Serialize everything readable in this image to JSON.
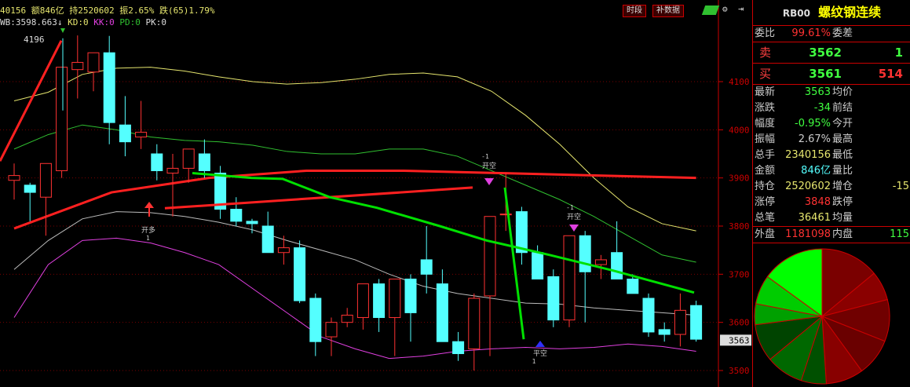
{
  "header": {
    "stats": "40156 额846亿 持2520602 振2.65% 跌(65)1.79%",
    "indicators_wb": "WB:3598.663↓",
    "indicators_kd": "KD:0",
    "indicators_kk": "KK:0",
    "indicators_pd": "PD:0",
    "indicators_pk": "PK:0",
    "high_label": "4196",
    "btn_timeshare": "时段",
    "btn_supplement": "补数据"
  },
  "axis": {
    "labels": [
      "4100",
      "4000",
      "3900",
      "3800",
      "3700",
      "3600",
      "3500"
    ],
    "current_price": "3563"
  },
  "signals": {
    "open_long": "开多",
    "open_long_n": "1",
    "open_short_1": "开空",
    "open_short_1_n": "-1",
    "open_short_2": "开空",
    "open_short_2_n": "-1",
    "close_short": "平空",
    "close_short_n": "1"
  },
  "colors": {
    "up": "#ff3232",
    "down": "#54ffff",
    "ma_fast": "#ff2020",
    "ma_slow": "#00e000",
    "upper_band": "#e6e66e",
    "mid_band": "#30c030",
    "lower_band": "#e040e0",
    "mid_line": "#bbbbbb",
    "accent_red": "#cc0000"
  },
  "chart_data": {
    "type": "candlestick",
    "ylim": [
      3490,
      4200
    ],
    "candles": [
      {
        "o": 3895,
        "h": 3930,
        "l": 3855,
        "c": 3905
      },
      {
        "o": 3885,
        "h": 3890,
        "l": 3810,
        "c": 3870
      },
      {
        "o": 3860,
        "h": 3870,
        "l": 3780,
        "c": 3930
      },
      {
        "o": 3915,
        "h": 4070,
        "l": 3900,
        "c": 4130
      },
      {
        "o": 4125,
        "h": 4196,
        "l": 4065,
        "c": 4140
      },
      {
        "o": 4120,
        "h": 4140,
        "l": 4080,
        "c": 4160
      },
      {
        "o": 4160,
        "h": 4195,
        "l": 3970,
        "c": 4015
      },
      {
        "o": 4010,
        "h": 4070,
        "l": 3945,
        "c": 3975
      },
      {
        "o": 3985,
        "h": 4060,
        "l": 3960,
        "c": 3995
      },
      {
        "o": 3950,
        "h": 3970,
        "l": 3895,
        "c": 3915
      },
      {
        "o": 3910,
        "h": 3950,
        "l": 3820,
        "c": 3920
      },
      {
        "o": 3920,
        "h": 3955,
        "l": 3890,
        "c": 3960
      },
      {
        "o": 3950,
        "h": 3980,
        "l": 3900,
        "c": 3915
      },
      {
        "o": 3910,
        "h": 3925,
        "l": 3815,
        "c": 3835
      },
      {
        "o": 3835,
        "h": 3860,
        "l": 3800,
        "c": 3810
      },
      {
        "o": 3810,
        "h": 3815,
        "l": 3785,
        "c": 3805
      },
      {
        "o": 3800,
        "h": 3830,
        "l": 3750,
        "c": 3745
      },
      {
        "o": 3745,
        "h": 3780,
        "l": 3720,
        "c": 3755
      },
      {
        "o": 3755,
        "h": 3770,
        "l": 3640,
        "c": 3645
      },
      {
        "o": 3650,
        "h": 3660,
        "l": 3530,
        "c": 3560
      },
      {
        "o": 3570,
        "h": 3610,
        "l": 3530,
        "c": 3600
      },
      {
        "o": 3600,
        "h": 3630,
        "l": 3590,
        "c": 3615
      },
      {
        "o": 3610,
        "h": 3640,
        "l": 3585,
        "c": 3680
      },
      {
        "o": 3680,
        "h": 3690,
        "l": 3580,
        "c": 3610
      },
      {
        "o": 3610,
        "h": 3670,
        "l": 3530,
        "c": 3690
      },
      {
        "o": 3690,
        "h": 3700,
        "l": 3560,
        "c": 3620
      },
      {
        "o": 3730,
        "h": 3800,
        "l": 3660,
        "c": 3700
      },
      {
        "o": 3680,
        "h": 3710,
        "l": 3570,
        "c": 3560
      },
      {
        "o": 3560,
        "h": 3580,
        "l": 3520,
        "c": 3535
      },
      {
        "o": 3545,
        "h": 3660,
        "l": 3500,
        "c": 3650
      },
      {
        "o": 3655,
        "h": 3700,
        "l": 3530,
        "c": 3820
      },
      {
        "o": 3825,
        "h": 3910,
        "l": 3790,
        "c": 3825
      },
      {
        "o": 3830,
        "h": 3840,
        "l": 3720,
        "c": 3745
      },
      {
        "o": 3745,
        "h": 3760,
        "l": 3700,
        "c": 3690
      },
      {
        "o": 3695,
        "h": 3710,
        "l": 3590,
        "c": 3605
      },
      {
        "o": 3605,
        "h": 3780,
        "l": 3590,
        "c": 3780
      },
      {
        "o": 3780,
        "h": 3790,
        "l": 3600,
        "c": 3705
      },
      {
        "o": 3720,
        "h": 3740,
        "l": 3690,
        "c": 3730
      },
      {
        "o": 3745,
        "h": 3810,
        "l": 3690,
        "c": 3690
      },
      {
        "o": 3690,
        "h": 3700,
        "l": 3660,
        "c": 3660
      },
      {
        "o": 3650,
        "h": 3660,
        "l": 3570,
        "c": 3580
      },
      {
        "o": 3585,
        "h": 3600,
        "l": 3560,
        "c": 3575
      },
      {
        "o": 3575,
        "h": 3660,
        "l": 3550,
        "c": 3625
      },
      {
        "o": 3635,
        "h": 3645,
        "l": 3560,
        "c": 3565
      }
    ]
  },
  "panel": {
    "code": "RB00",
    "name": "螺纹钢连续",
    "rows_top": [
      {
        "a": "委比",
        "b": "99.61%",
        "bc": "#ff3232",
        "c": "委差",
        "d": "",
        "dc": "#ff3232"
      }
    ],
    "sell": {
      "a": "卖",
      "b": "3562",
      "bc": "#40ff40",
      "d": "1",
      "dc": "#40ff40"
    },
    "buy": {
      "a": "买",
      "b": "3561",
      "bc": "#40ff40",
      "d": "514",
      "dc": "#ff3232"
    },
    "rows": [
      {
        "a": "最新",
        "b": "3563",
        "bc": "#40ff40",
        "c": "均价",
        "d": "",
        "dc": "#ccc"
      },
      {
        "a": "涨跌",
        "b": "-34",
        "bc": "#40ff40",
        "c": "前结",
        "d": "",
        "dc": "#ccc"
      },
      {
        "a": "幅度",
        "b": "-0.95%",
        "bc": "#40ff40",
        "c": "今开",
        "d": "",
        "dc": "#ccc"
      },
      {
        "a": "振幅",
        "b": "2.67%",
        "bc": "#cccccc",
        "c": "最高",
        "d": "",
        "dc": "#ccc"
      },
      {
        "a": "总手",
        "b": "2340156",
        "bc": "#e6e66e",
        "c": "最低",
        "d": "",
        "dc": "#ccc"
      },
      {
        "a": "金额",
        "b": "846亿",
        "bc": "#54ffff",
        "c": "量比",
        "d": "",
        "dc": "#ccc"
      },
      {
        "a": "持仓",
        "b": "2520602",
        "bc": "#e6e66e",
        "c": "增仓",
        "d": "-15",
        "dc": "#e6e66e"
      },
      {
        "a": "涨停",
        "b": "3848",
        "bc": "#ff3232",
        "c": "跌停",
        "d": "",
        "dc": "#ccc"
      },
      {
        "a": "总笔",
        "b": "36461",
        "bc": "#e6e66e",
        "c": "均量",
        "d": "",
        "dc": "#ccc"
      }
    ],
    "outer": {
      "a": "外盘",
      "b": "1181098",
      "bc": "#ff3232",
      "c": "内盘",
      "d": "115",
      "dc": "#40ff40"
    }
  }
}
